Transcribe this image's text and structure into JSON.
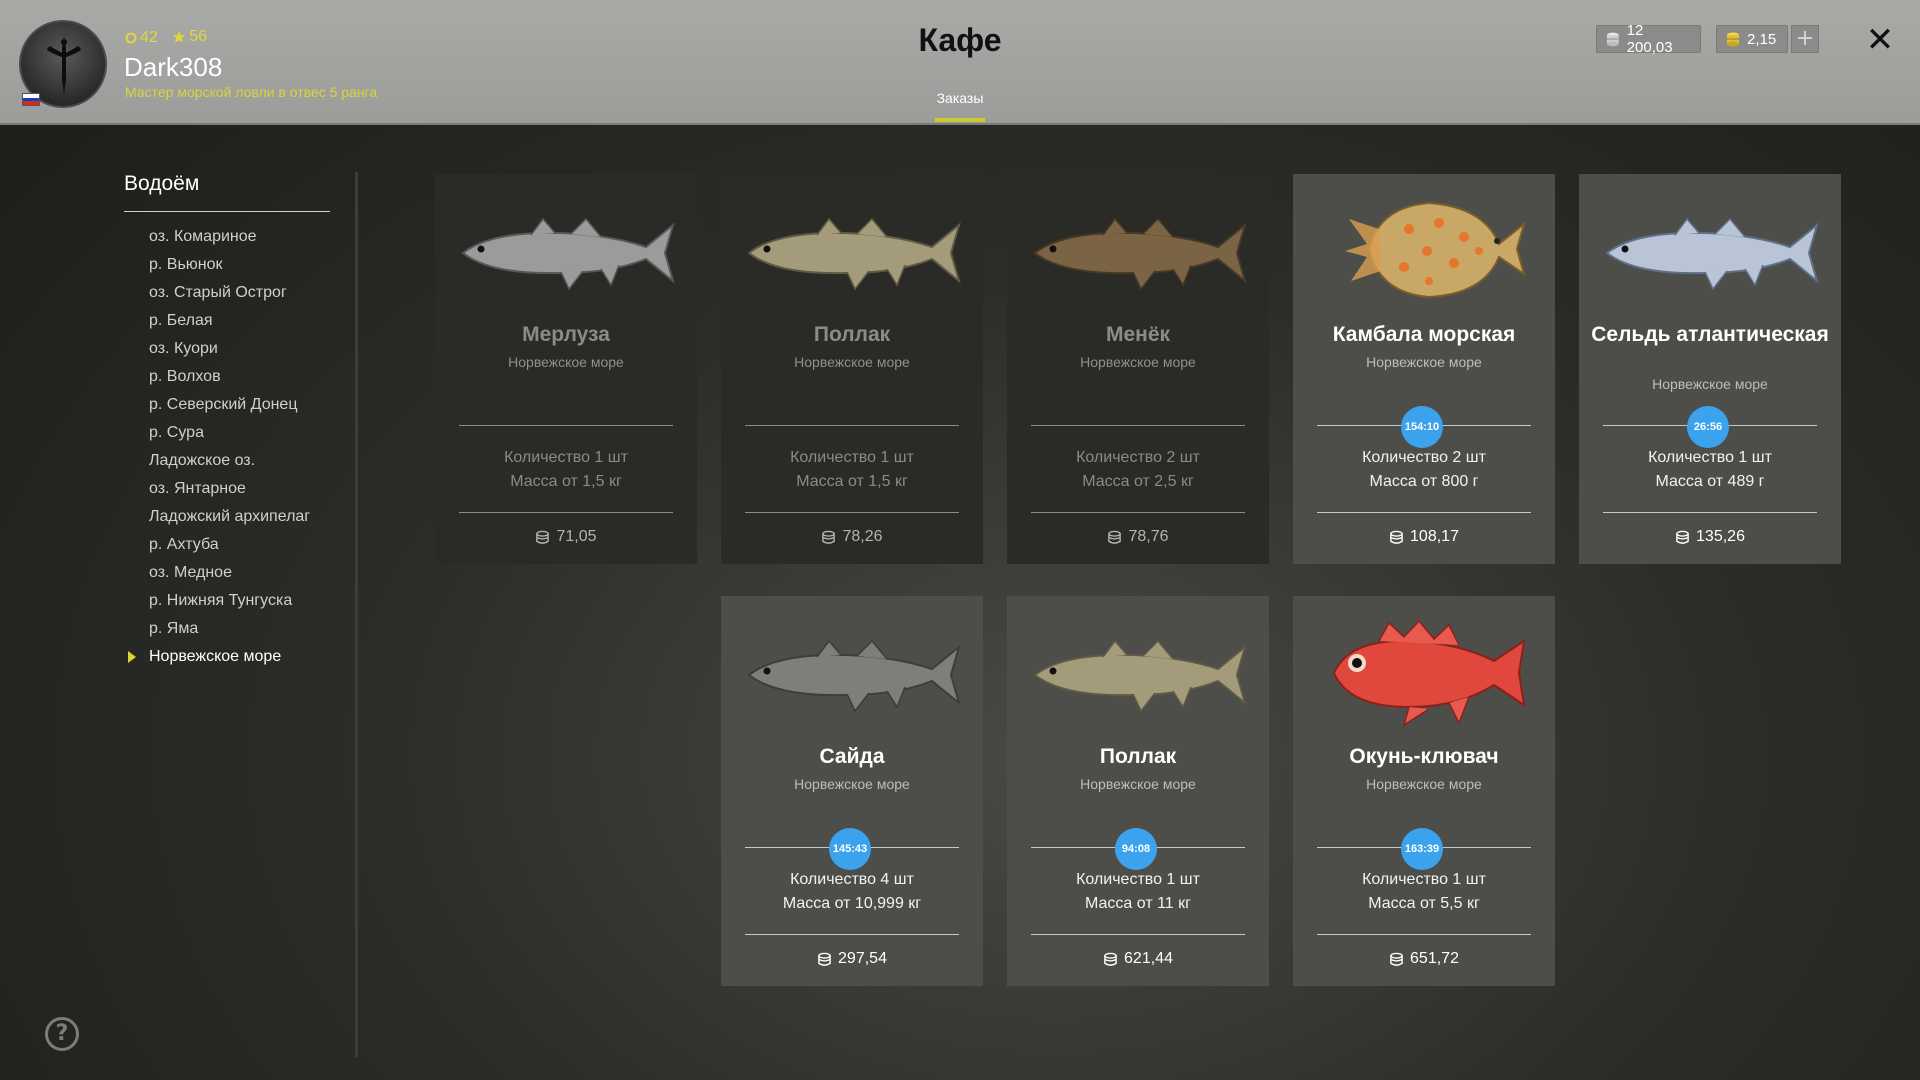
{
  "header": {
    "title": "Кафе",
    "tab_orders": "Заказы",
    "player": {
      "level": "42",
      "stars": "56",
      "name": "Dark308",
      "rank": "Мастер морской ловли в отвес 5 ранга"
    },
    "currency": {
      "silver": "12 200,03",
      "gold": "2,15"
    },
    "add_label": "+",
    "close_label": "✕"
  },
  "sidebar": {
    "title": "Водоём",
    "items": [
      "оз. Комариное",
      "р. Вьюнок",
      "оз. Старый Острог",
      "р. Белая",
      "оз. Куори",
      "р. Волхов",
      "р. Северский Донец",
      "р. Сура",
      "Ладожское оз.",
      "оз. Янтарное",
      "Ладожский архипелаг",
      "р. Ахтуба",
      "оз. Медное",
      "р. Нижняя Тунгуска",
      "р. Яма",
      "Норвежское море"
    ],
    "active_index": 15,
    "help_label": "?"
  },
  "orders": [
    {
      "name": "Мерлуза",
      "location": "Норвежское море",
      "qty": "Количество 1 шт",
      "mass": "Масса от 1,5 кг",
      "reward": "71,05",
      "active": false,
      "fish_icon": "hake-icon"
    },
    {
      "name": "Поллак",
      "location": "Норвежское море",
      "qty": "Количество 1 шт",
      "mass": "Масса от 1,5 кг",
      "reward": "78,26",
      "active": false,
      "fish_icon": "pollack-icon"
    },
    {
      "name": "Менёк",
      "location": "Норвежское море",
      "qty": "Количество 2 шт",
      "mass": "Масса от 2,5 кг",
      "reward": "78,76",
      "active": false,
      "fish_icon": "tusk-icon"
    },
    {
      "name": "Камбала морская",
      "location": "Норвежское море",
      "timer": "154:10",
      "qty": "Количество 2 шт",
      "mass": "Масса от 800 г",
      "reward": "108,17",
      "active": true,
      "fish_icon": "plaice-icon"
    },
    {
      "name": "Сельдь атлантическая",
      "location": "Норвежское море",
      "timer": "26:56",
      "qty": "Количество 1 шт",
      "mass": "Масса от 489 г",
      "reward": "135,26",
      "active": true,
      "fish_icon": "herring-icon"
    },
    {
      "name": "Сайда",
      "location": "Норвежское море",
      "timer": "145:43",
      "qty": "Количество 4 шт",
      "mass": "Масса от 10,999 кг",
      "reward": "297,54",
      "active": true,
      "fish_icon": "saithe-icon"
    },
    {
      "name": "Поллак",
      "location": "Норвежское море",
      "timer": "94:08",
      "qty": "Количество 1 шт",
      "mass": "Масса от 11 кг",
      "reward": "621,44",
      "active": true,
      "fish_icon": "pollack-icon"
    },
    {
      "name": "Окунь-клювач",
      "location": "Норвежское море",
      "timer": "163:39",
      "qty": "Количество 1 шт",
      "mass": "Масса от 5,5 кг",
      "reward": "651,72",
      "active": true,
      "fish_icon": "redfish-icon"
    }
  ]
}
